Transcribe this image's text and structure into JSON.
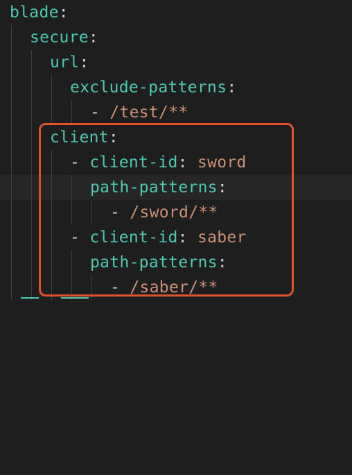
{
  "editor": {
    "theme": "dark",
    "colors": {
      "background": "#1e1e1e",
      "key": "#4ec9b0",
      "value": "#ce9178",
      "punctuation": "#d4d4d4",
      "highlight_box": "#e2532a"
    },
    "lines": [
      {
        "key": "blade",
        "colon": ":"
      },
      {
        "key": "secure",
        "colon": ":"
      },
      {
        "key": "url",
        "colon": ":"
      },
      {
        "key": "exclude-patterns",
        "colon": ":"
      },
      {
        "dash": "-",
        "value": "/test/**"
      },
      {
        "key": "client",
        "colon": ":"
      },
      {
        "dash": "-",
        "key": "client-id",
        "colon": ":",
        "value": "sword"
      },
      {
        "key": "path-patterns",
        "colon": ":"
      },
      {
        "dash": "-",
        "value": "/sword/**"
      },
      {
        "dash": "-",
        "key": "client-id",
        "colon": ":",
        "value": "saber"
      },
      {
        "key": "path-patterns",
        "colon": ":"
      },
      {
        "dash": "-",
        "value": "/saber/**"
      }
    ]
  }
}
